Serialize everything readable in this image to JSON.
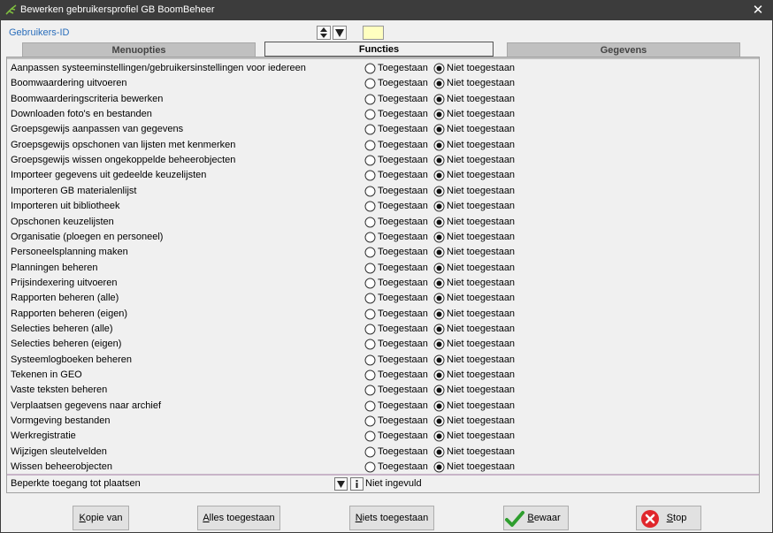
{
  "window": {
    "title": "Bewerken gebruikersprofiel GB BoomBeheer",
    "close_glyph": "✕"
  },
  "header": {
    "user_id_label": "Gebruikers-ID",
    "user_id_value": ""
  },
  "tabs": [
    {
      "label": "Menuopties",
      "active": false
    },
    {
      "label": "Functies",
      "active": true
    },
    {
      "label": "Gegevens",
      "active": false
    }
  ],
  "options": {
    "allowed": "Toegestaan",
    "not_allowed": "Niet toegestaan"
  },
  "functions": [
    {
      "label": "Aanpassen systeeminstellingen/gebruikersinstellingen voor iedereen",
      "value": "not_allowed"
    },
    {
      "label": "Boomwaardering uitvoeren",
      "value": "not_allowed"
    },
    {
      "label": "Boomwaarderingscriteria bewerken",
      "value": "not_allowed"
    },
    {
      "label": "Downloaden foto's en bestanden",
      "value": "not_allowed"
    },
    {
      "label": "Groepsgewijs aanpassen van gegevens",
      "value": "not_allowed"
    },
    {
      "label": "Groepsgewijs opschonen van lijsten met kenmerken",
      "value": "not_allowed"
    },
    {
      "label": "Groepsgewijs wissen ongekoppelde beheerobjecten",
      "value": "not_allowed"
    },
    {
      "label": "Importeer gegevens uit gedeelde keuzelijsten",
      "value": "not_allowed"
    },
    {
      "label": "Importeren GB materialenlijst",
      "value": "not_allowed"
    },
    {
      "label": "Importeren uit bibliotheek",
      "value": "not_allowed"
    },
    {
      "label": "Opschonen keuzelijsten",
      "value": "not_allowed"
    },
    {
      "label": "Organisatie (ploegen en personeel)",
      "value": "not_allowed"
    },
    {
      "label": "Personeelsplanning maken",
      "value": "not_allowed"
    },
    {
      "label": "Planningen beheren",
      "value": "not_allowed"
    },
    {
      "label": "Prijsindexering uitvoeren",
      "value": "not_allowed"
    },
    {
      "label": "Rapporten beheren (alle)",
      "value": "not_allowed"
    },
    {
      "label": "Rapporten beheren (eigen)",
      "value": "not_allowed"
    },
    {
      "label": "Selecties beheren (alle)",
      "value": "not_allowed"
    },
    {
      "label": "Selecties beheren (eigen)",
      "value": "not_allowed"
    },
    {
      "label": "Systeemlogboeken beheren",
      "value": "not_allowed"
    },
    {
      "label": "Tekenen in GEO",
      "value": "not_allowed"
    },
    {
      "label": "Vaste teksten beheren",
      "value": "not_allowed"
    },
    {
      "label": "Verplaatsen gegevens naar archief",
      "value": "not_allowed"
    },
    {
      "label": "Vormgeving bestanden",
      "value": "not_allowed"
    },
    {
      "label": "Werkregistratie",
      "value": "not_allowed"
    },
    {
      "label": "Wijzigen sleutelvelden",
      "value": "not_allowed"
    },
    {
      "label": "Wissen beheerobjecten",
      "value": "not_allowed"
    }
  ],
  "restricted_access": {
    "label": "Beperkte toegang tot plaatsen",
    "value": "Niet ingevuld"
  },
  "buttons": {
    "copy": {
      "accel": "K",
      "rest": "opie van"
    },
    "all_allowed": {
      "accel": "A",
      "rest": "lles toegestaan"
    },
    "none_allowed": {
      "accel": "N",
      "rest": "iets toegestaan"
    },
    "save": {
      "accel": "B",
      "rest": "ewaar"
    },
    "stop": {
      "accel": "S",
      "rest": "top"
    }
  },
  "colors": {
    "titlebar": "#3c3c3c",
    "user_id_label": "#2a6ebb",
    "user_id_field": "#ffffc0",
    "save_check": "#2e9e2e",
    "stop_red": "#e0262b"
  }
}
